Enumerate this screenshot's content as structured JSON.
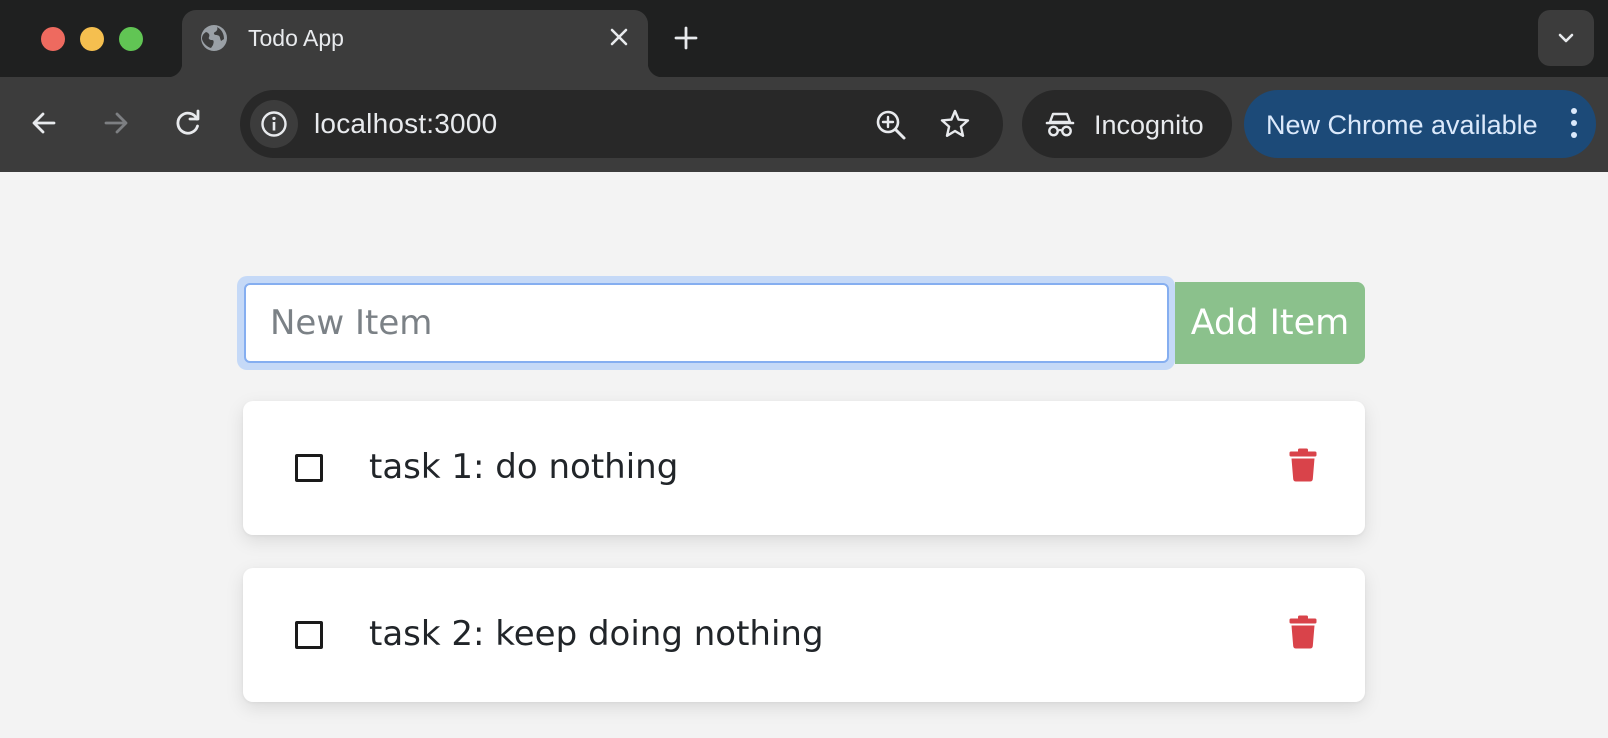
{
  "browser": {
    "tab": {
      "title": "Todo App"
    },
    "url": "localhost:3000",
    "incognito_label": "Incognito",
    "update_label": "New Chrome available"
  },
  "todo": {
    "input_placeholder": "New Item",
    "input_value": "",
    "add_button_label": "Add Item",
    "items": [
      {
        "text": "task 1: do nothing",
        "done": false
      },
      {
        "text": "task 2: keep doing nothing",
        "done": false
      }
    ]
  },
  "colors": {
    "add_button": "#8bc18c",
    "trash_icon": "#d9434a",
    "input_focus_ring": "#c5d9f7",
    "page_background": "#f3f3f3",
    "update_pill": "#1c4a78"
  },
  "icons": {
    "tab": "globe-icon",
    "back": "arrow-left-icon",
    "forward": "arrow-right-icon",
    "reload": "reload-icon",
    "site_info": "info-icon",
    "zoom": "zoom-in-icon",
    "bookmark": "star-icon",
    "incognito": "incognito-icon",
    "item_delete": "trash-icon"
  }
}
